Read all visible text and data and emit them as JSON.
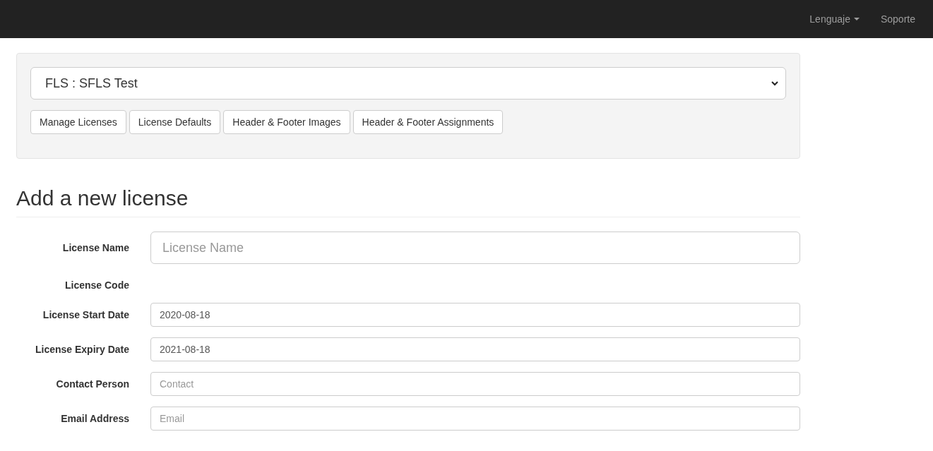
{
  "navbar": {
    "items": [
      {
        "label": "Lenguaje",
        "kind": "dropdown"
      },
      {
        "label": "Soporte",
        "kind": "link"
      }
    ]
  },
  "panel": {
    "select": {
      "value": "FLS : SFLS Test"
    },
    "buttons": [
      "Manage Licenses",
      "License Defaults",
      "Header & Footer Images",
      "Header & Footer Assignments"
    ]
  },
  "form": {
    "heading": "Add a new license",
    "fields": [
      {
        "label": "License Name",
        "kind": "large",
        "placeholder": "License Name"
      },
      {
        "label": "License Code",
        "kind": "none"
      },
      {
        "label": "License Start Date",
        "kind": "input",
        "value": "2020-08-18"
      },
      {
        "label": "License Expiry Date",
        "kind": "input",
        "value": "2021-08-18"
      },
      {
        "label": "Contact Person",
        "kind": "input",
        "placeholder": "Contact"
      },
      {
        "label": "Email Address",
        "kind": "input",
        "placeholder": "Email"
      }
    ]
  }
}
